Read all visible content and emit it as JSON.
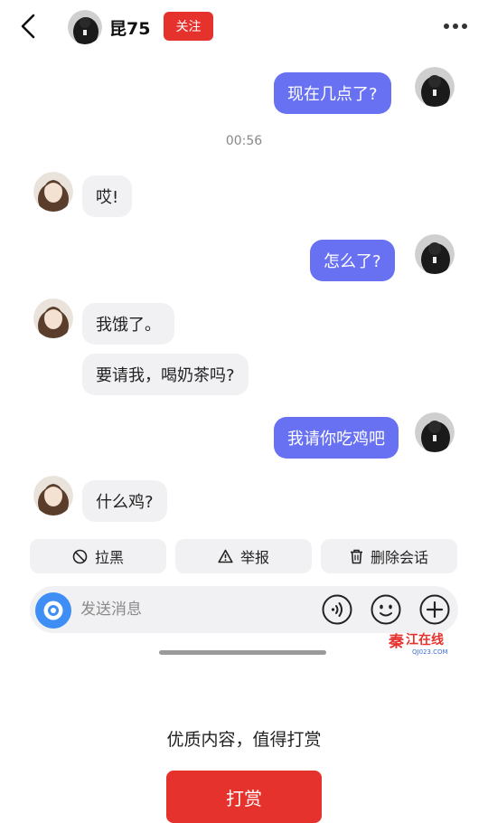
{
  "header": {
    "back_icon": "chevron-left-icon",
    "contact_name": "昆75",
    "follow_label": "关注",
    "more_icon": "more-horizontal-icon"
  },
  "messages": [
    {
      "side": "out",
      "text": "现在几点了?"
    },
    {
      "side": "in",
      "text": "哎!"
    },
    {
      "side": "out",
      "text": "怎么了?"
    },
    {
      "side": "in",
      "text": "我饿了。"
    },
    {
      "side": "in",
      "text": "要请我，喝奶茶吗?"
    },
    {
      "side": "out",
      "text": "我请你吃鸡吧"
    },
    {
      "side": "in",
      "text": "什么鸡?"
    }
  ],
  "timestamp": "00:56",
  "actions": {
    "block_label": "拉黑",
    "report_label": "举报",
    "delete_label": "删除会话"
  },
  "composer": {
    "placeholder": "发送消息",
    "camera_icon": "camera-icon",
    "voice_icon": "voice-icon",
    "emoji_icon": "emoji-icon",
    "plus_icon": "plus-icon"
  },
  "watermark": {
    "line1": "秦江在线",
    "line2": "QJ023.COM"
  },
  "tip": {
    "text": "优质内容，值得打赏",
    "button_label": "打赏"
  },
  "colors": {
    "accent_red": "#e5322d",
    "outgoing_bubble": "#6871f2",
    "incoming_bubble": "#f1f1f3",
    "camera_blue": "#3e8ef5"
  }
}
